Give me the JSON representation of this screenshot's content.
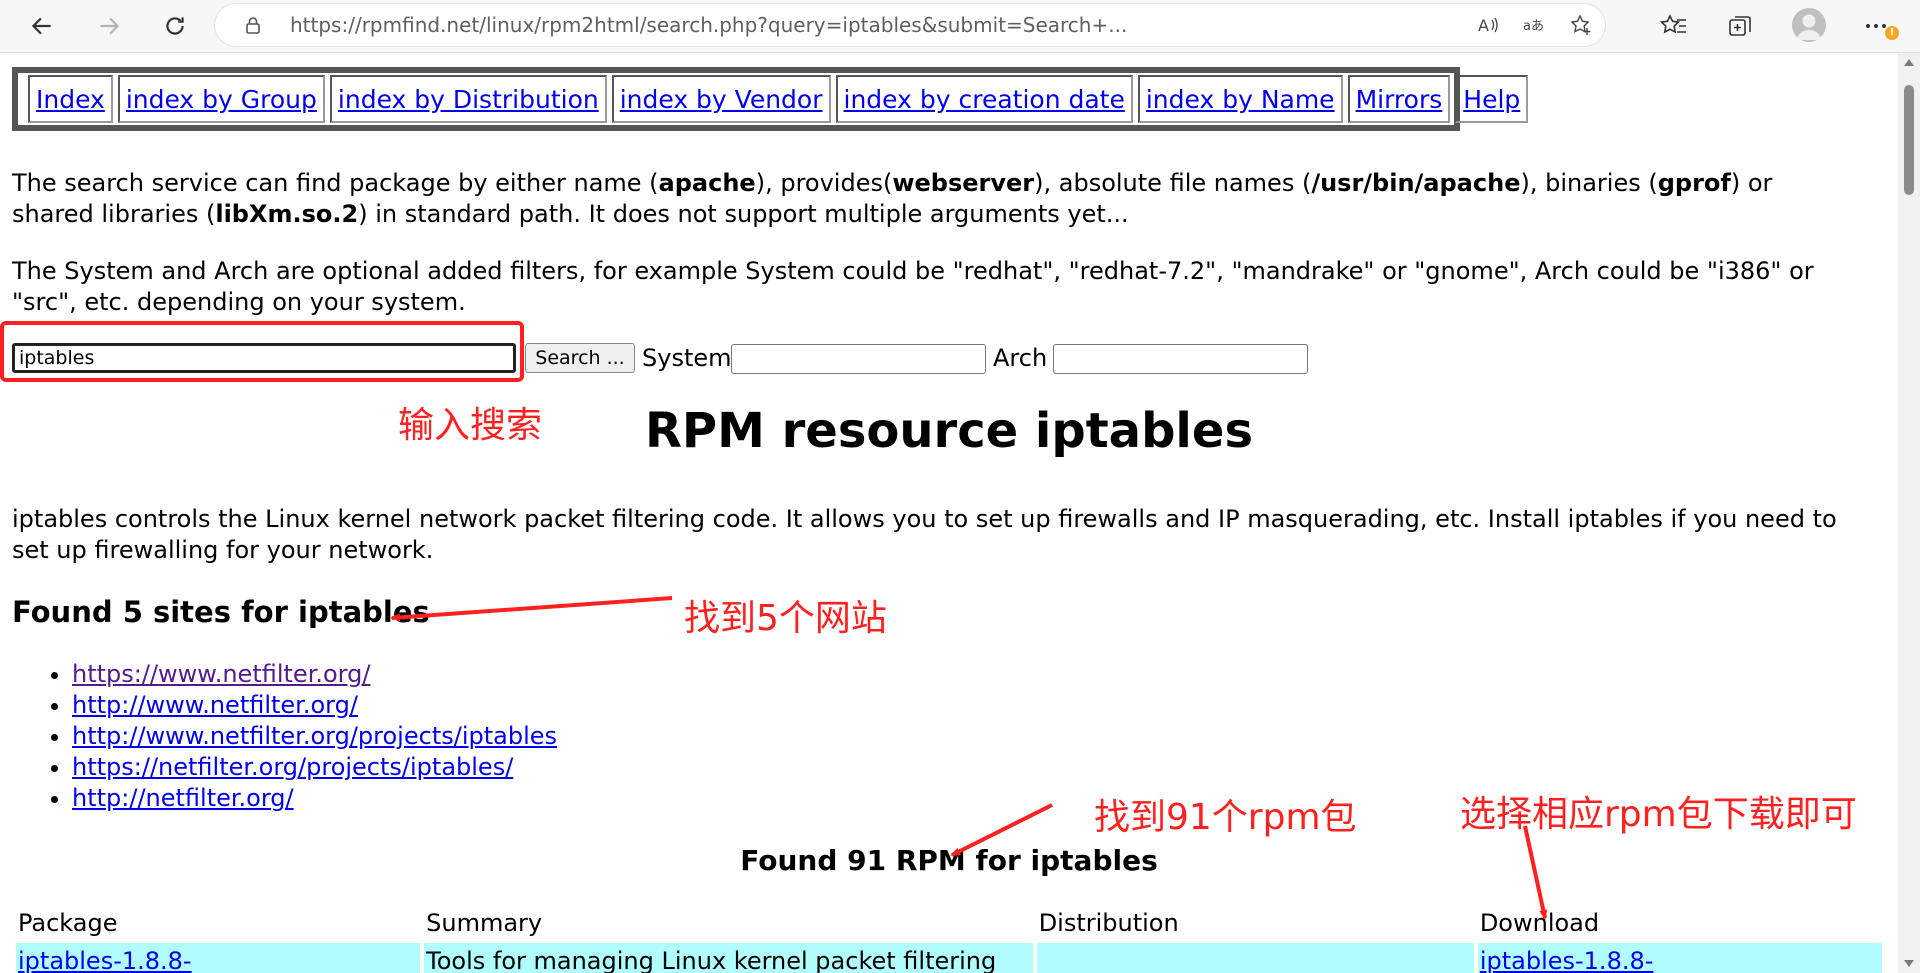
{
  "browser": {
    "url": "https://rpmfind.net/linux/rpm2html/search.php?query=iptables&submit=Search+...",
    "read_aloud_icon": "read-aloud-icon",
    "translate_icon": "translate-icon",
    "warning_badge": "!"
  },
  "nav": {
    "items": [
      {
        "label": "Index"
      },
      {
        "label": "index by Group"
      },
      {
        "label": "index by Distribution"
      },
      {
        "label": "index by Vendor"
      },
      {
        "label": "index by creation date"
      },
      {
        "label": "index by Name"
      },
      {
        "label": "Mirrors"
      },
      {
        "label": "Help"
      }
    ]
  },
  "intro": {
    "p1_a": "The search service can find package by either name (",
    "p1_b": "apache",
    "p1_c": "), provides(",
    "p1_d": "webserver",
    "p1_e": "), absolute file names (",
    "p1_f": "/usr/bin/apache",
    "p1_g": "), binaries (",
    "p1_h": "gprof",
    "p1_i": ") or shared libraries (",
    "p1_j": "libXm.so.2",
    "p1_k": ") in standard path. It does not support multiple arguments yet...",
    "p2": "The System and Arch are optional added filters, for example System could be \"redhat\", \"redhat-7.2\", \"mandrake\" or \"gnome\", Arch could be \"i386\" or \"src\", etc. depending on your system."
  },
  "search": {
    "query_value": "iptables",
    "button_label": "Search ...",
    "system_label": "System",
    "system_value": "",
    "arch_label": "Arch",
    "arch_value": ""
  },
  "title": "RPM resource iptables",
  "description": "iptables controls the Linux kernel network packet filtering code. It allows you to set up firewalls and IP masquerading, etc. Install iptables if you need to set up firewalling for your network.",
  "sites": {
    "heading": "Found 5 sites for iptables",
    "items": [
      "https://www.netfilter.org/",
      "http://www.netfilter.org/",
      "http://www.netfilter.org/projects/iptables",
      "https://netfilter.org/projects/iptables/",
      "http://netfilter.org/"
    ]
  },
  "rpms": {
    "heading": "Found 91 RPM for iptables",
    "columns": [
      "Package",
      "Summary",
      "Distribution",
      "Download"
    ],
    "first_row": {
      "package": "iptables-1.8.8-",
      "summary": "Tools for managing Linux kernel packet filtering",
      "distribution": "",
      "download": "iptables-1.8.8-"
    }
  },
  "annotations": {
    "search_note": "输入搜索",
    "sites_note": "找到5个网站",
    "rpm_note": "找到91个rpm包",
    "download_note": "选择相应rpm包下载即可",
    "color": "#ff2020"
  }
}
